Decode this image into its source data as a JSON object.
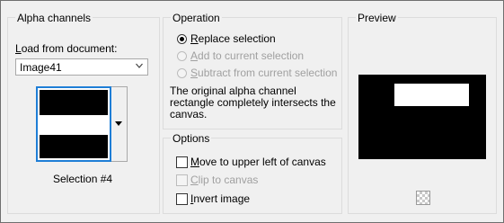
{
  "alpha": {
    "title": "Alpha channels",
    "load_label": "Load from document:",
    "document_value": "Image41",
    "selection_caption": "Selection #4"
  },
  "operation": {
    "title": "Operation",
    "options": [
      {
        "label": "Replace selection",
        "selected": true,
        "enabled": true
      },
      {
        "label": "Add to current selection",
        "selected": false,
        "enabled": false
      },
      {
        "label": "Subtract from current selection",
        "selected": false,
        "enabled": false
      }
    ],
    "description": "The original alpha channel rectangle completely intersects the canvas."
  },
  "options": {
    "title": "Options",
    "items": [
      {
        "label": "Move to upper left of canvas",
        "checked": false,
        "enabled": true
      },
      {
        "label": "Clip to canvas",
        "checked": false,
        "enabled": false
      },
      {
        "label": "Invert image",
        "checked": false,
        "enabled": true
      }
    ]
  },
  "preview": {
    "title": "Preview"
  }
}
